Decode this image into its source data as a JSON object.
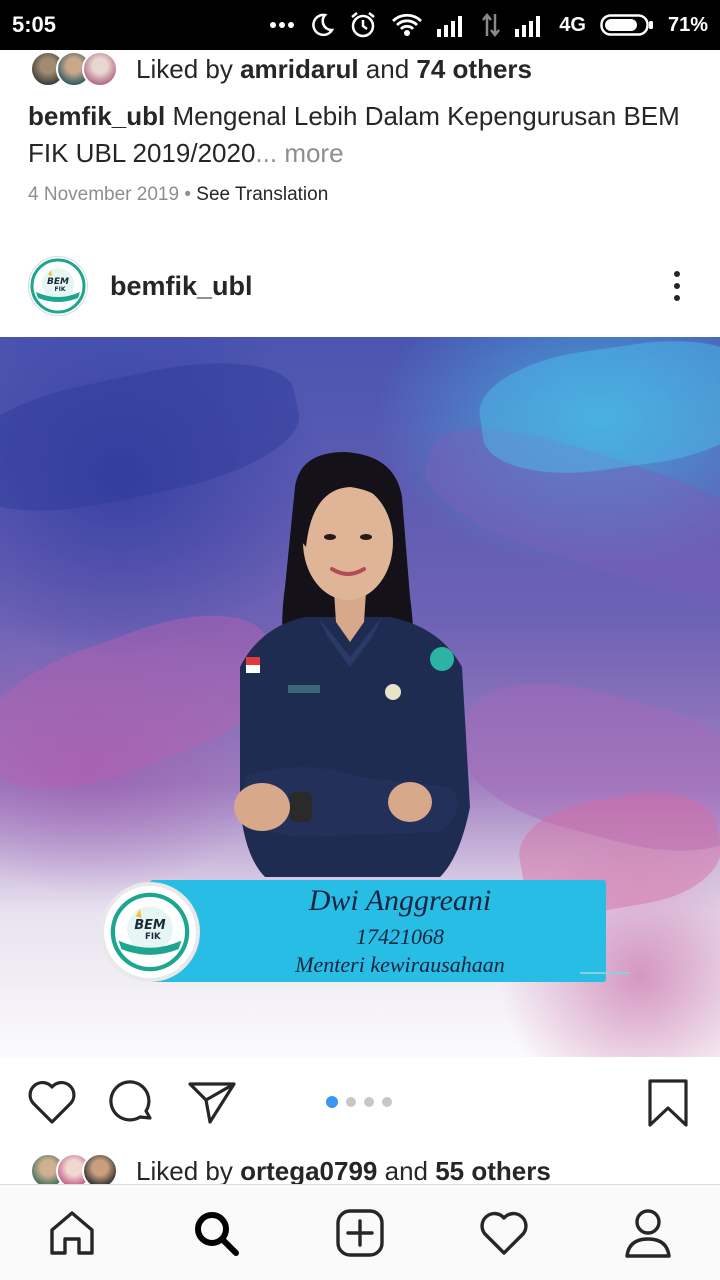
{
  "status_bar": {
    "time": "5:05",
    "network": "4G",
    "battery": "71%"
  },
  "previous_post": {
    "liked_prefix": "Liked by ",
    "liked_user": "amridarul",
    "liked_mid": " and ",
    "liked_count": "74 others",
    "caption_user": "bemfik_ubl",
    "caption_text": " Mengenal Lebih Dalam Kepengurusan BEM FIK UBL 2019/2020",
    "caption_more": "... more",
    "date": "4 November 2019",
    "separator": " • ",
    "see_translation": "See Translation"
  },
  "post": {
    "username": "bemfik_ubl",
    "card_name": "Dwi Anggreani",
    "card_id": "17421068",
    "card_role": "Menteri kewirausahaan",
    "logo_text_top": "BEM",
    "logo_text_bottom": "FIK",
    "carousel_count": 4,
    "carousel_active": 1
  },
  "next_likes": {
    "liked_prefix": "Liked by ",
    "liked_user": "ortega0799",
    "liked_mid": " and ",
    "liked_count": "55 others"
  },
  "icons": {
    "like": "heart-icon",
    "comment": "comment-icon",
    "share": "send-icon",
    "save": "bookmark-icon",
    "nav": [
      "home-icon",
      "search-icon",
      "add-post-icon",
      "activity-heart-icon",
      "profile-icon"
    ]
  },
  "colors": {
    "accent_blue": "#3897f0",
    "card_cyan": "#27bde4",
    "text": "#262626",
    "muted": "#8e8e8e"
  }
}
